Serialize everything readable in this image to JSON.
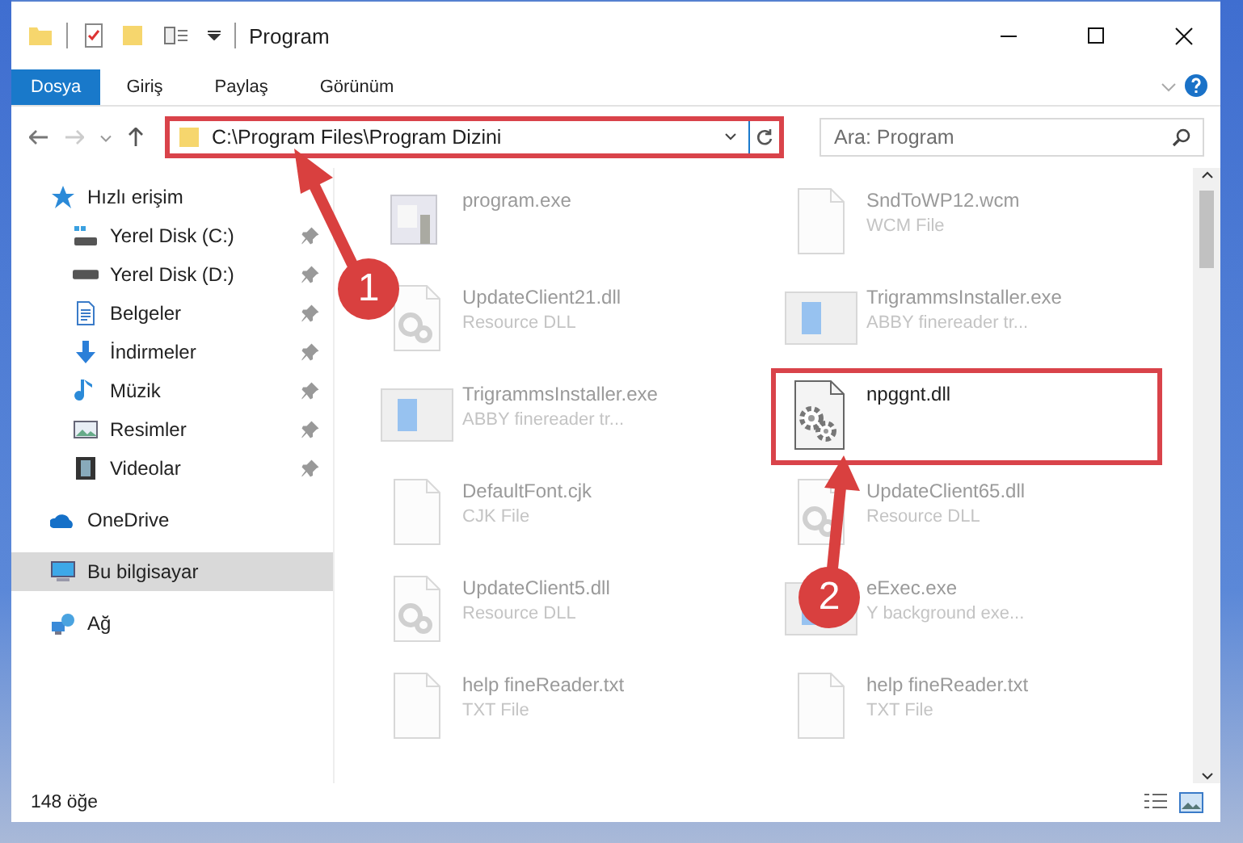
{
  "window": {
    "title": "Program"
  },
  "ribbon_tabs": [
    {
      "label": "Dosya",
      "selected": true
    },
    {
      "label": "Giriş",
      "selected": false
    },
    {
      "label": "Paylaş",
      "selected": false
    },
    {
      "label": "Görünüm",
      "selected": false
    }
  ],
  "address_bar": {
    "path": "C:\\Program Files\\Program Dizini",
    "highlighted": true
  },
  "search": {
    "placeholder": "Ara: Program"
  },
  "sidebar": {
    "items": [
      {
        "label": "Hızlı erişim",
        "kind": "star",
        "selected": false,
        "children": [
          {
            "label": "Yerel Disk (C:)",
            "kind": "drivec",
            "selected": false
          },
          {
            "label": "Yerel Disk (D:)",
            "kind": "drive",
            "selected": false
          },
          {
            "label": "Belgeler",
            "kind": "documents",
            "selected": false
          },
          {
            "label": "İndirmeler",
            "kind": "downloads",
            "selected": false
          },
          {
            "label": "Müzik",
            "kind": "music",
            "selected": false
          },
          {
            "label": "Resimler",
            "kind": "pictures",
            "selected": false
          },
          {
            "label": "Videolar",
            "kind": "videos",
            "selected": false
          }
        ]
      },
      {
        "label": "OneDrive",
        "kind": "cloud",
        "selected": false
      },
      {
        "label": "Bu bilgisayar",
        "kind": "computer",
        "selected": true
      },
      {
        "label": "Ağ",
        "kind": "network",
        "selected": false
      }
    ]
  },
  "files": [
    {
      "name": "program.exe",
      "kind": "program",
      "blurred": true,
      "highlighted": false
    },
    {
      "name": "SndToWP12.wcm",
      "type": "WCM File",
      "kind": "blank",
      "blurred": true,
      "highlighted": false
    },
    {
      "name": "UpdateClient21.dll",
      "type": "Resource DLL",
      "kind": "resource",
      "blurred": true,
      "highlighted": false
    },
    {
      "name": "TrigrammsInstaller.exe",
      "type": "ABBY finereader tr...",
      "kind": "installer",
      "blurred": true,
      "highlighted": false
    },
    {
      "name": "TrigrammsInstaller.exe",
      "type": "ABBY finereader tr...",
      "kind": "installer",
      "blurred": true,
      "highlighted": false
    },
    {
      "name": "npggnt.dll",
      "kind": "gear",
      "blurred": false,
      "highlighted": true
    },
    {
      "name": "DefaultFont.cjk",
      "type": "CJK File",
      "kind": "blank",
      "blurred": true,
      "highlighted": false
    },
    {
      "name": "UpdateClient65.dll",
      "type": "Resource DLL",
      "kind": "resource",
      "blurred": true,
      "highlighted": false
    },
    {
      "name": "UpdateClient5.dll",
      "type": "Resource DLL",
      "kind": "resource",
      "blurred": true,
      "highlighted": false
    },
    {
      "name": "eExec.exe",
      "type": "Y background exe...",
      "kind": "installer",
      "blurred": true,
      "highlighted": false
    },
    {
      "name": "help fineReader.txt",
      "type": "TXT File",
      "kind": "text",
      "blurred": true,
      "highlighted": false
    },
    {
      "name": "help fineReader.txt",
      "type": "TXT File",
      "kind": "text",
      "blurred": true,
      "highlighted": false
    }
  ],
  "status_bar": {
    "item_count": "148 öğe"
  },
  "callouts": [
    {
      "number": "1"
    },
    {
      "number": "2"
    }
  ]
}
